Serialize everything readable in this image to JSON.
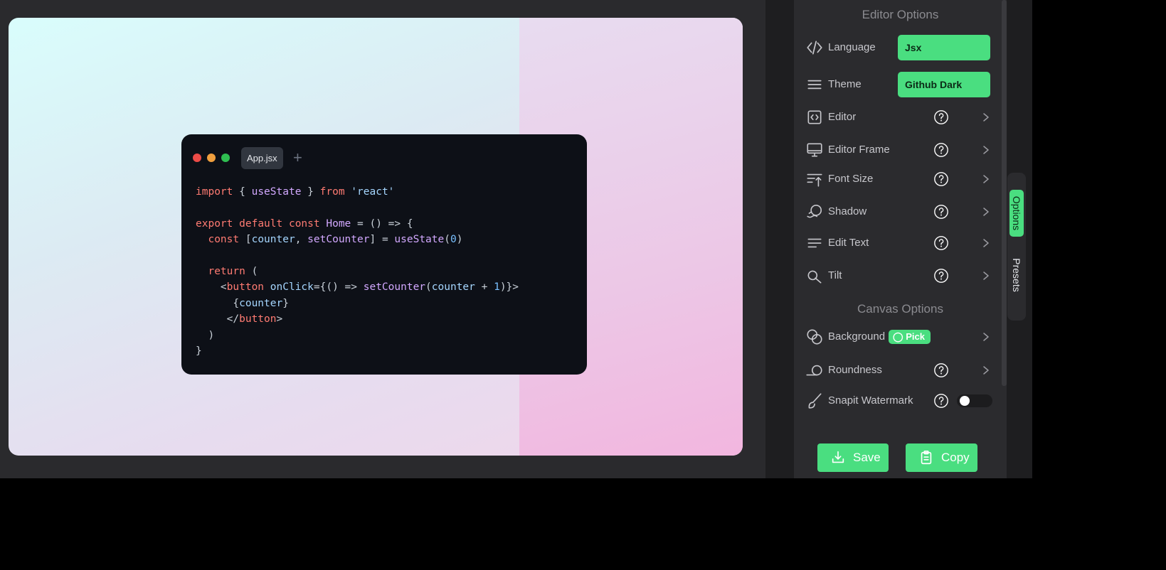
{
  "canvas": {
    "file_tab": "App.jsx",
    "new_tab_icon": "plus-icon",
    "code_lines": [
      "import { useState } from 'react'",
      "",
      "export default const Home = () => {",
      "  const [counter, setCounter] = useState(0)",
      "",
      "  return (",
      "    <button onClick={() => setCounter(counter + 1)}>",
      "      {counter}",
      "     </button>",
      "  )",
      "}"
    ]
  },
  "editor_options": {
    "title": "Editor Options",
    "language": {
      "label": "Language",
      "value": "Jsx",
      "icon": "code-icon"
    },
    "theme": {
      "label": "Theme",
      "value": "Github Dark",
      "icon": "menu-icon"
    },
    "items": [
      {
        "label": "Editor",
        "icon": "code-box-icon"
      },
      {
        "label": "Editor Frame",
        "icon": "monitor-icon"
      },
      {
        "label": "Font Size",
        "icon": "font-size-icon"
      },
      {
        "label": "Shadow",
        "icon": "shadow-icon"
      },
      {
        "label": "Edit Text",
        "icon": "text-lines-icon"
      },
      {
        "label": "Tilt",
        "icon": "tilt-icon"
      }
    ]
  },
  "canvas_options": {
    "title": "Canvas Options",
    "background": {
      "label": "Background",
      "pick_label": "Pick",
      "icon": "circles-icon"
    },
    "roundness": {
      "label": "Roundness",
      "icon": "roundness-icon"
    },
    "watermark": {
      "label": "Snapit Watermark",
      "icon": "brush-icon",
      "enabled": false
    }
  },
  "actions": {
    "save_label": "Save",
    "copy_label": "Copy"
  },
  "side_tabs": {
    "options": "Options",
    "presets": "Presets"
  },
  "colors": {
    "accent": "#4ade80",
    "panel": "#2b2b2e"
  }
}
